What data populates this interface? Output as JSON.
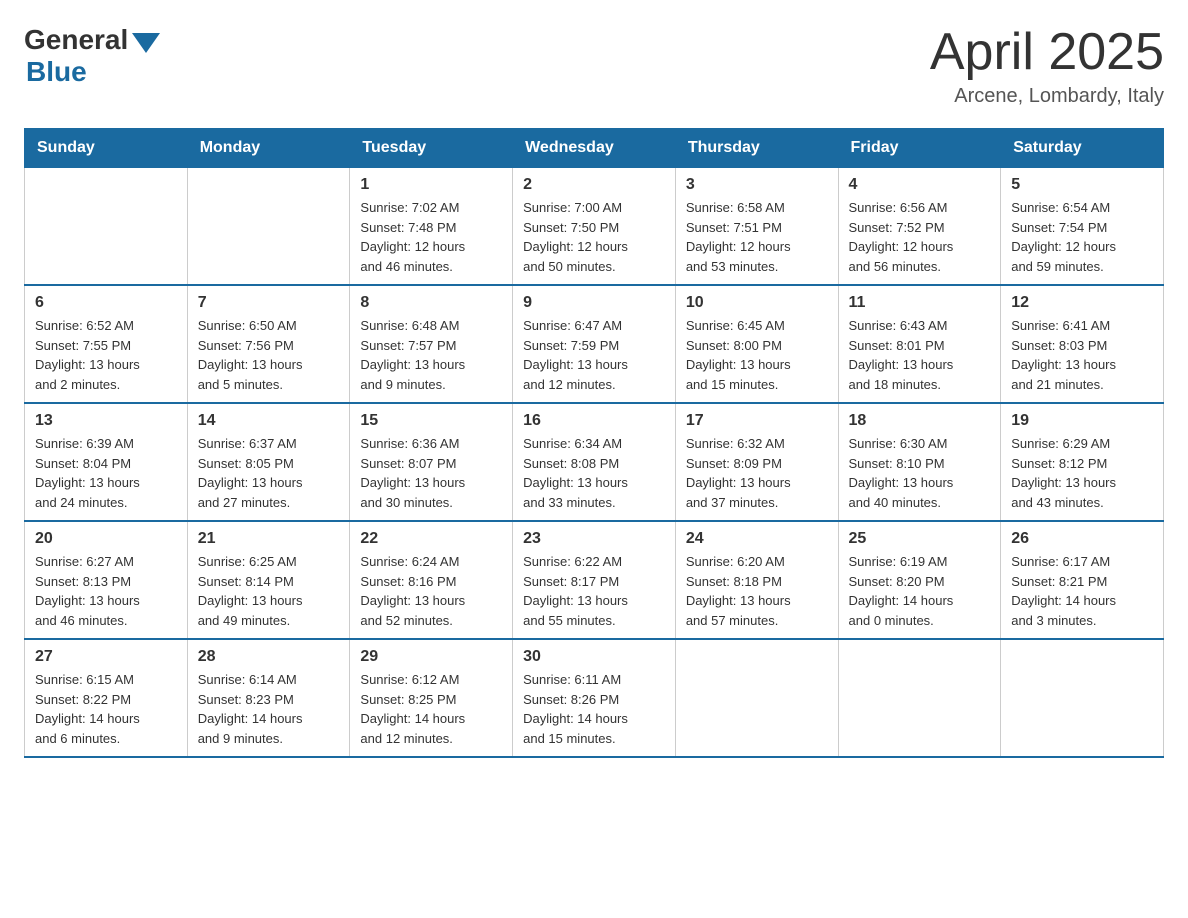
{
  "header": {
    "logo_general": "General",
    "logo_blue": "Blue",
    "month_title": "April 2025",
    "location": "Arcene, Lombardy, Italy"
  },
  "weekdays": [
    "Sunday",
    "Monday",
    "Tuesday",
    "Wednesday",
    "Thursday",
    "Friday",
    "Saturday"
  ],
  "weeks": [
    [
      {
        "day": "",
        "info": ""
      },
      {
        "day": "",
        "info": ""
      },
      {
        "day": "1",
        "info": "Sunrise: 7:02 AM\nSunset: 7:48 PM\nDaylight: 12 hours\nand 46 minutes."
      },
      {
        "day": "2",
        "info": "Sunrise: 7:00 AM\nSunset: 7:50 PM\nDaylight: 12 hours\nand 50 minutes."
      },
      {
        "day": "3",
        "info": "Sunrise: 6:58 AM\nSunset: 7:51 PM\nDaylight: 12 hours\nand 53 minutes."
      },
      {
        "day": "4",
        "info": "Sunrise: 6:56 AM\nSunset: 7:52 PM\nDaylight: 12 hours\nand 56 minutes."
      },
      {
        "day": "5",
        "info": "Sunrise: 6:54 AM\nSunset: 7:54 PM\nDaylight: 12 hours\nand 59 minutes."
      }
    ],
    [
      {
        "day": "6",
        "info": "Sunrise: 6:52 AM\nSunset: 7:55 PM\nDaylight: 13 hours\nand 2 minutes."
      },
      {
        "day": "7",
        "info": "Sunrise: 6:50 AM\nSunset: 7:56 PM\nDaylight: 13 hours\nand 5 minutes."
      },
      {
        "day": "8",
        "info": "Sunrise: 6:48 AM\nSunset: 7:57 PM\nDaylight: 13 hours\nand 9 minutes."
      },
      {
        "day": "9",
        "info": "Sunrise: 6:47 AM\nSunset: 7:59 PM\nDaylight: 13 hours\nand 12 minutes."
      },
      {
        "day": "10",
        "info": "Sunrise: 6:45 AM\nSunset: 8:00 PM\nDaylight: 13 hours\nand 15 minutes."
      },
      {
        "day": "11",
        "info": "Sunrise: 6:43 AM\nSunset: 8:01 PM\nDaylight: 13 hours\nand 18 minutes."
      },
      {
        "day": "12",
        "info": "Sunrise: 6:41 AM\nSunset: 8:03 PM\nDaylight: 13 hours\nand 21 minutes."
      }
    ],
    [
      {
        "day": "13",
        "info": "Sunrise: 6:39 AM\nSunset: 8:04 PM\nDaylight: 13 hours\nand 24 minutes."
      },
      {
        "day": "14",
        "info": "Sunrise: 6:37 AM\nSunset: 8:05 PM\nDaylight: 13 hours\nand 27 minutes."
      },
      {
        "day": "15",
        "info": "Sunrise: 6:36 AM\nSunset: 8:07 PM\nDaylight: 13 hours\nand 30 minutes."
      },
      {
        "day": "16",
        "info": "Sunrise: 6:34 AM\nSunset: 8:08 PM\nDaylight: 13 hours\nand 33 minutes."
      },
      {
        "day": "17",
        "info": "Sunrise: 6:32 AM\nSunset: 8:09 PM\nDaylight: 13 hours\nand 37 minutes."
      },
      {
        "day": "18",
        "info": "Sunrise: 6:30 AM\nSunset: 8:10 PM\nDaylight: 13 hours\nand 40 minutes."
      },
      {
        "day": "19",
        "info": "Sunrise: 6:29 AM\nSunset: 8:12 PM\nDaylight: 13 hours\nand 43 minutes."
      }
    ],
    [
      {
        "day": "20",
        "info": "Sunrise: 6:27 AM\nSunset: 8:13 PM\nDaylight: 13 hours\nand 46 minutes."
      },
      {
        "day": "21",
        "info": "Sunrise: 6:25 AM\nSunset: 8:14 PM\nDaylight: 13 hours\nand 49 minutes."
      },
      {
        "day": "22",
        "info": "Sunrise: 6:24 AM\nSunset: 8:16 PM\nDaylight: 13 hours\nand 52 minutes."
      },
      {
        "day": "23",
        "info": "Sunrise: 6:22 AM\nSunset: 8:17 PM\nDaylight: 13 hours\nand 55 minutes."
      },
      {
        "day": "24",
        "info": "Sunrise: 6:20 AM\nSunset: 8:18 PM\nDaylight: 13 hours\nand 57 minutes."
      },
      {
        "day": "25",
        "info": "Sunrise: 6:19 AM\nSunset: 8:20 PM\nDaylight: 14 hours\nand 0 minutes."
      },
      {
        "day": "26",
        "info": "Sunrise: 6:17 AM\nSunset: 8:21 PM\nDaylight: 14 hours\nand 3 minutes."
      }
    ],
    [
      {
        "day": "27",
        "info": "Sunrise: 6:15 AM\nSunset: 8:22 PM\nDaylight: 14 hours\nand 6 minutes."
      },
      {
        "day": "28",
        "info": "Sunrise: 6:14 AM\nSunset: 8:23 PM\nDaylight: 14 hours\nand 9 minutes."
      },
      {
        "day": "29",
        "info": "Sunrise: 6:12 AM\nSunset: 8:25 PM\nDaylight: 14 hours\nand 12 minutes."
      },
      {
        "day": "30",
        "info": "Sunrise: 6:11 AM\nSunset: 8:26 PM\nDaylight: 14 hours\nand 15 minutes."
      },
      {
        "day": "",
        "info": ""
      },
      {
        "day": "",
        "info": ""
      },
      {
        "day": "",
        "info": ""
      }
    ]
  ]
}
